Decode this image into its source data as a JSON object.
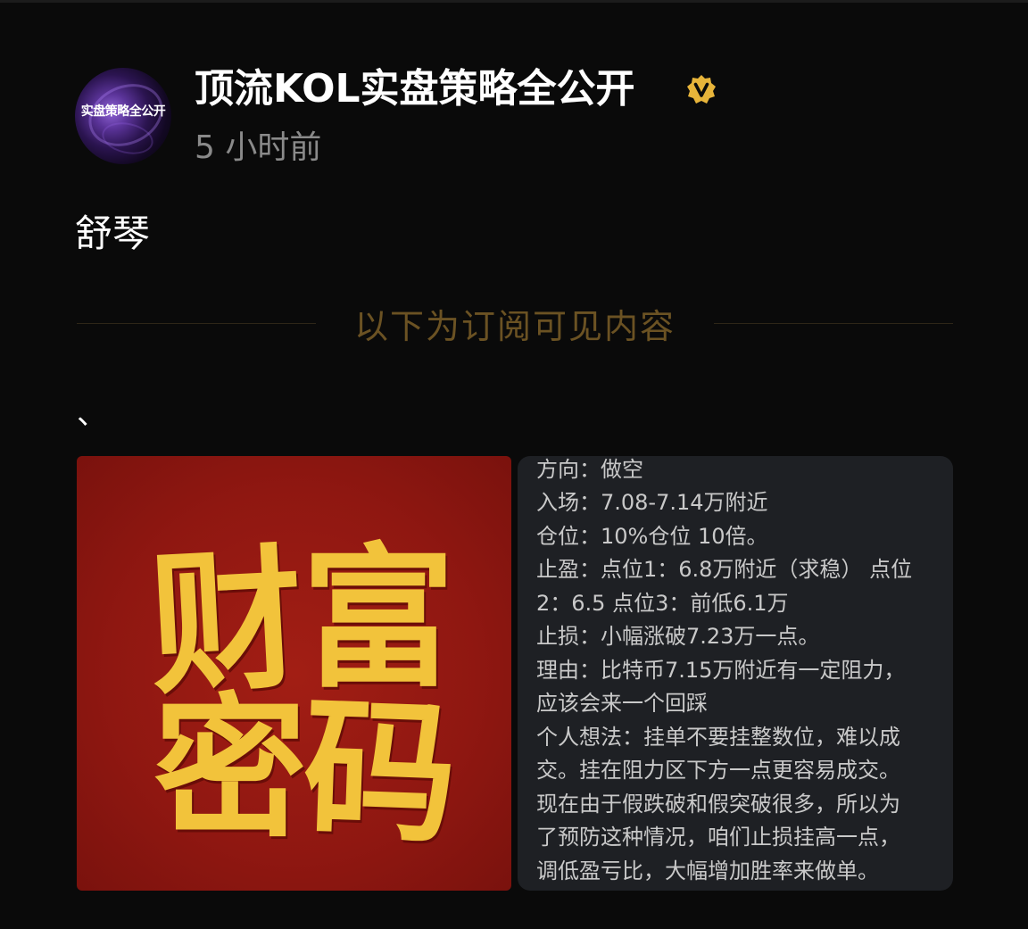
{
  "author": {
    "avatar_text": "实盘策略全公开",
    "name": "顶流KOL实盘策略全公开",
    "verified_icon": "verified-v-badge-icon",
    "post_time": "5 小时前"
  },
  "post": {
    "title": "舒琴",
    "divider_text": "以下为订阅可见内容",
    "content_mark": "、"
  },
  "poster": {
    "chars": [
      "财",
      "富",
      "密",
      "码"
    ],
    "bg_color": "#9a1a12",
    "text_color": "#f2c33b"
  },
  "note": {
    "lines": [
      "方向：做空",
      "入场：7.08-7.14万附近",
      "仓位：10%仓位 10倍。",
      "止盈：点位1：6.8万附近（求稳） 点位",
      "2：6.5 点位3：前低6.1万",
      "止损：小幅涨破7.23万一点。",
      "理由：比特币7.15万附近有一定阻力，",
      "应该会来一个回踩",
      "个人想法：挂单不要挂整数位，难以成",
      "交。挂在阻力区下方一点更容易成交。",
      "现在由于假跌破和假突破很多，所以为",
      "了预防这种情况，咱们止损挂高一点，",
      "调低盈亏比，大幅增加胜率来做单。"
    ]
  },
  "colors": {
    "background": "#0a0a0a",
    "divider_text": "#6b5223",
    "muted_text": "#8a8a8a",
    "verified_badge": "#e7b43a"
  }
}
